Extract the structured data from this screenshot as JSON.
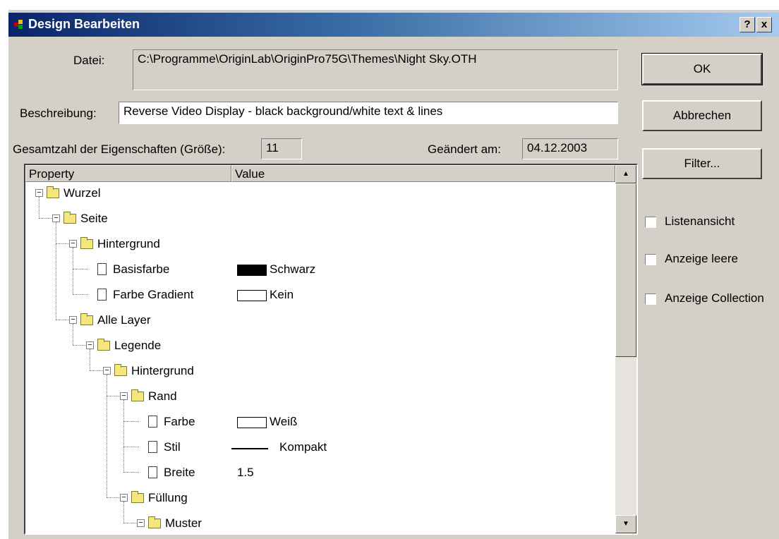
{
  "window": {
    "title": "Design Bearbeiten",
    "help_label": "?",
    "close_label": "x"
  },
  "file": {
    "label": "Datei:",
    "value": "C:\\Programme\\OriginLab\\OriginPro75G\\Themes\\Night Sky.OTH"
  },
  "description": {
    "label": "Beschreibung:",
    "value": "Reverse Video Display - black background/white text & lines"
  },
  "total": {
    "label": "Gesamtzahl der Eigenschaften (Größe):",
    "value": "11"
  },
  "modified": {
    "label": "Geändert am:",
    "value": "04.12.2003"
  },
  "buttons": {
    "ok": "OK",
    "cancel": "Abbrechen",
    "filter": "Filter..."
  },
  "checkboxes": [
    {
      "label": "Listenansicht",
      "checked": false
    },
    {
      "label": "Anzeige leere",
      "checked": false
    },
    {
      "label": "Anzeige Collection",
      "checked": false
    }
  ],
  "columns": {
    "property": "Property",
    "value": "Value"
  },
  "tree": [
    {
      "label": "Wurzel",
      "type": "folder",
      "level": 0,
      "expanded": true
    },
    {
      "label": "Seite",
      "type": "folder",
      "level": 1,
      "expanded": true
    },
    {
      "label": "Hintergrund",
      "type": "folder",
      "level": 2,
      "expanded": true
    },
    {
      "label": "Basisfarbe",
      "type": "leaf",
      "level": 3,
      "value": "Schwarz",
      "swatch": "#000000"
    },
    {
      "label": "Farbe Gradient",
      "type": "leaf",
      "level": 3,
      "value": "Kein",
      "swatch": "#ffffff"
    },
    {
      "label": "Alle Layer",
      "type": "folder",
      "level": 2,
      "expanded": true
    },
    {
      "label": "Legende",
      "type": "folder",
      "level": 3,
      "expanded": true
    },
    {
      "label": "Hintergrund",
      "type": "folder",
      "level": 4,
      "expanded": true
    },
    {
      "label": "Rand",
      "type": "folder",
      "level": 5,
      "expanded": true
    },
    {
      "label": "Farbe",
      "type": "leaf",
      "level": 6,
      "value": "Weiß",
      "swatch": "#ffffff"
    },
    {
      "label": "Stil",
      "type": "leaf",
      "level": 6,
      "value": "Kompakt",
      "line": true
    },
    {
      "label": "Breite",
      "type": "leaf",
      "level": 6,
      "value": "1.5"
    },
    {
      "label": "Füllung",
      "type": "folder",
      "level": 5,
      "expanded": true
    },
    {
      "label": "Muster",
      "type": "folder",
      "level": 6,
      "expanded": true
    }
  ]
}
